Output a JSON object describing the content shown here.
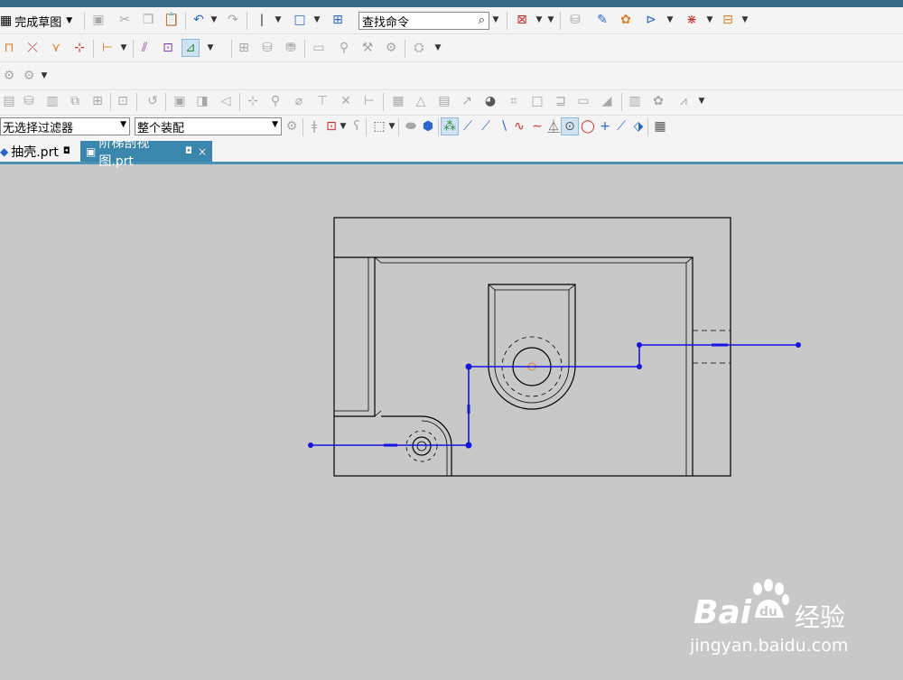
{
  "toolbar": {
    "finish_sketch_label": "完成草图",
    "search_placeholder": "查找命令"
  },
  "selection_bar": {
    "filter_value": "无选择过滤器",
    "scope_value": "整个装配"
  },
  "tabs": [
    {
      "label": "抽壳.prt",
      "active": false
    },
    {
      "label": "阶梯剖视图.prt",
      "active": true
    }
  ],
  "watermark": {
    "brand": "Bai",
    "brand_cn": "经验",
    "url": "jingyan.baidu.com"
  },
  "colors": {
    "section_line": "#1515e0",
    "tab_active": "#3a86ad",
    "canvas_bg": "#c8c8c8"
  }
}
